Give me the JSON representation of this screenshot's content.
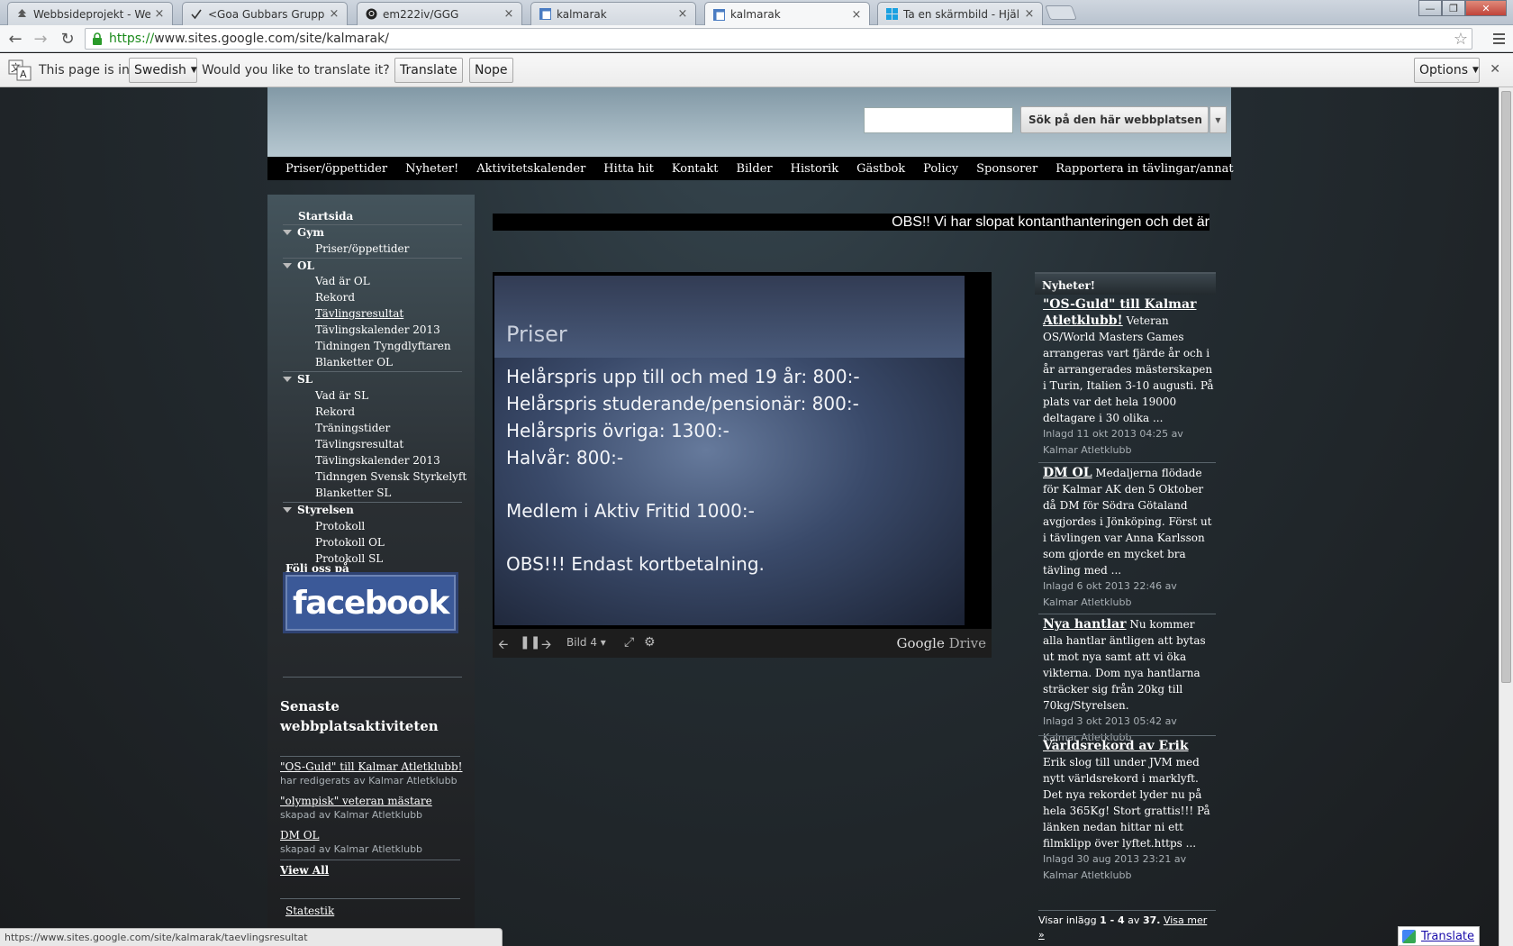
{
  "browser": {
    "tabs": [
      {
        "label": "Webbsideprojekt - Webbt",
        "icon": "tree-icon",
        "close": "×"
      },
      {
        "label": "<Goa Gubbars Grupp(GGG",
        "icon": "checkmark-icon",
        "close": "×"
      },
      {
        "label": "em222iv/GGG",
        "icon": "github-icon",
        "close": "×"
      },
      {
        "label": "kalmarak",
        "icon": "sites-icon",
        "close": "×"
      },
      {
        "label": "kalmarak",
        "icon": "sites-icon",
        "close": "×",
        "active": true
      },
      {
        "label": "Ta en skärmbild - Hjälp om",
        "icon": "windows-icon",
        "close": "×"
      }
    ],
    "url_scheme": "https://",
    "url_rest": "www.sites.google.com/site/kalmarak/",
    "status_url": "https://www.sites.google.com/site/kalmarak/taevlingsresultat"
  },
  "translate_bar": {
    "page_is_in": "This page is in",
    "language": "Swedish",
    "question": "Would you like to translate it?",
    "translate": "Translate",
    "nope": "Nope",
    "options": "Options"
  },
  "header": {
    "search_button": "Sök på den här webbplatsen",
    "search_value": ""
  },
  "nav": [
    "Priser/öppettider",
    "Nyheter!",
    "Aktivitetskalender",
    "Hitta hit",
    "Kontakt",
    "Bilder",
    "Historik",
    "Gästbok",
    "Policy",
    "Sponsorer",
    "Rapportera in tävlingar/annat"
  ],
  "sidebar": {
    "start": "Startsida",
    "gym": {
      "label": "Gym",
      "items": [
        "Priser/öppettider"
      ]
    },
    "ol": {
      "label": "OL",
      "items": [
        "Vad är OL",
        "Rekord",
        "Tävlingsresultat",
        "Tävlingskalender 2013",
        "Tidningen Tyngdlyftaren",
        "Blanketter OL"
      ]
    },
    "sl": {
      "label": "SL",
      "items": [
        "Vad är SL",
        "Rekord",
        "Träningstider",
        "Tävlingsresultat",
        "Tävlingskalender 2013",
        "Tidnngen Svensk Styrkelyft",
        "Blanketter SL"
      ]
    },
    "styrelsen": {
      "label": "Styrelsen",
      "items": [
        "Protokoll",
        "Protokoll OL",
        "Protokoll SL"
      ]
    },
    "follow": "Följ oss på",
    "facebook": "facebook",
    "activity_title": "Senaste webbplatsaktiviteten",
    "activity": [
      {
        "link": "\"OS-Guld\" till Kalmar Atletklubb!",
        "sub": "har redigerats av Kalmar Atletklubb"
      },
      {
        "link": "\"olympisk\" veteran mästare",
        "sub": "skapad av Kalmar Atletklubb"
      },
      {
        "link": "DM OL",
        "sub": "skapad av Kalmar Atletklubb"
      }
    ],
    "view_all": "View All",
    "stats": "Statestik"
  },
  "marquee": "OBS!! Vi har slopat kontanthanteringen och det är",
  "slideshow": {
    "title": "Priser",
    "lines": [
      "Helårspris upp till och med 19 år: 800:-",
      "Helårspris studerande/pensionär: 800:-",
      "Helårspris övriga: 1300:-",
      "Halvår: 800:-",
      "Medlem i Aktiv Fritid 1000:-",
      "OBS!!! Endast kortbetalning."
    ],
    "slide_label": "Bild 4",
    "brand_google": "Google",
    "brand_drive": "Drive"
  },
  "news": {
    "heading": "Nyheter!",
    "items": [
      {
        "title": "\"OS-Guld\" till Kalmar Atletklubb!",
        "body": "Veteran OS/World Masters Games arrangeras vart fjärde år och i år arrangerades mästerskapen i Turin, Italien 3-10 augusti. På plats var det hela 19000 deltagare i 30 olika ...",
        "meta": "Inlagd 11 okt 2013 04:25 av Kalmar Atletklubb"
      },
      {
        "title": "DM OL",
        "body": "Medaljerna flödade för Kalmar AK den 5 Oktober då DM för Södra Götaland avgjordes i Jönköping. Först ut i tävlingen var Anna Karlsson som gjorde en mycket bra tävling med ...",
        "meta": "Inlagd 6 okt 2013 22:46 av Kalmar Atletklubb"
      },
      {
        "title": "Nya hantlar",
        "body": "Nu kommer alla hantlar äntligen att bytas ut mot nya samt att vi öka vikterna. Dom nya hantlarna sträcker sig från 20kg till 70kg/Styrelsen.",
        "meta": "Inlagd 3 okt 2013 05:42 av Kalmar Atletklubb"
      },
      {
        "title": "Världsrekord av Erik",
        "body": "Erik slog till under JVM med nytt världsrekord i marklyft. Det nya rekordet lyder nu på hela 365Kg! Stort grattis!!! På länken nedan hittar ni ett filmklipp över lyftet.https ...",
        "meta": "Inlagd 30 aug 2013 23:21 av Kalmar Atletklubb"
      }
    ],
    "footer_prefix": "Visar inlägg",
    "footer_range": "1 - 4",
    "footer_of": "av",
    "footer_total": "37.",
    "footer_more": "Visa mer »"
  },
  "translate_widget": "Translate"
}
